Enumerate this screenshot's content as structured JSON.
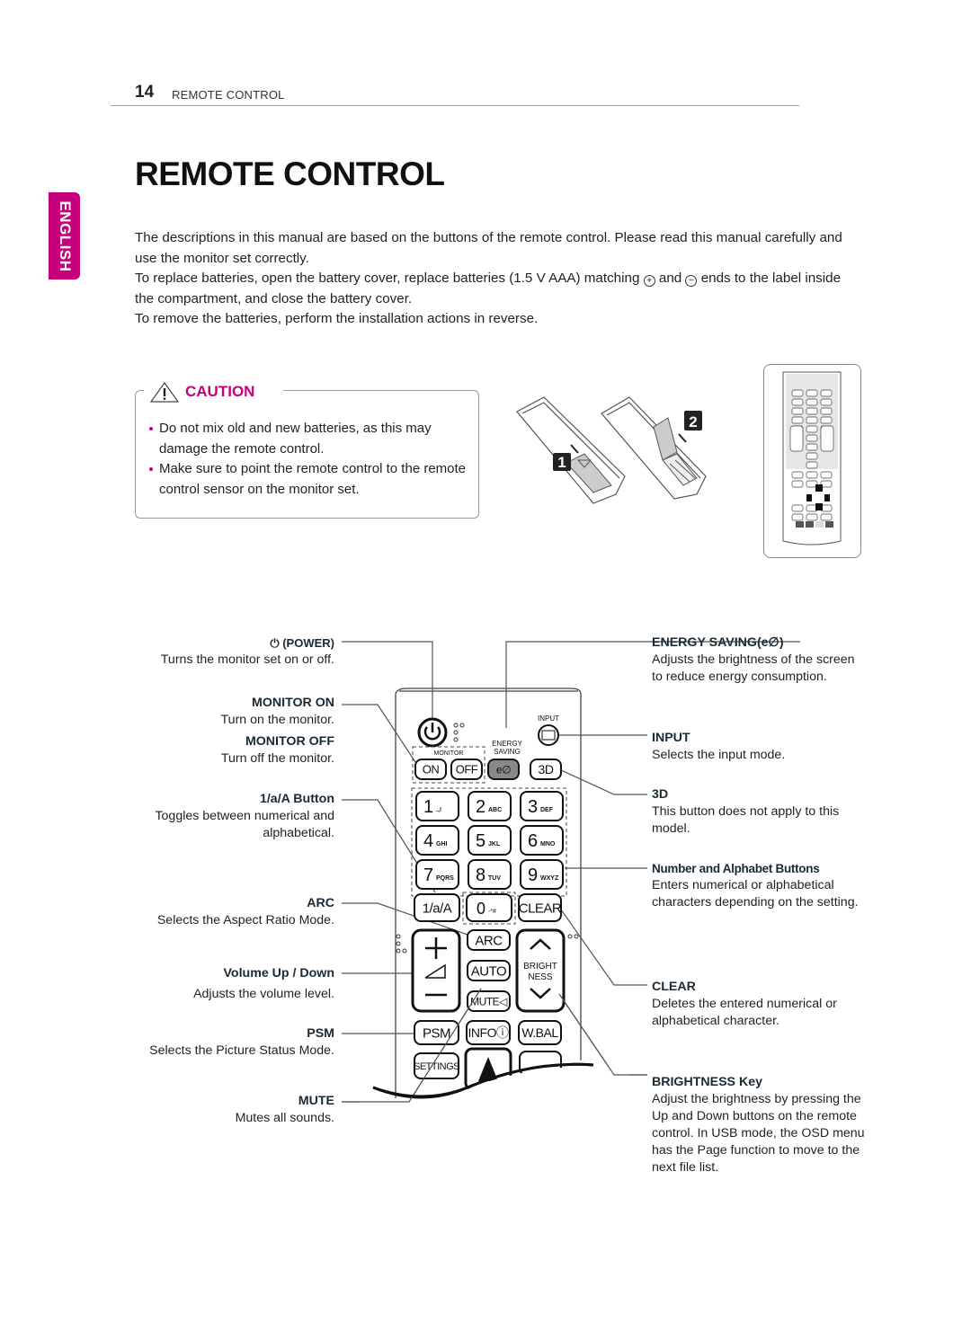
{
  "header": {
    "page_number": "14",
    "section": "REMOTE CONTROL"
  },
  "title": "REMOTE CONTROL",
  "language_tab": "ENGLISH",
  "intro": {
    "p1": "The descriptions in this manual are based on the buttons of the remote control. Please read this manual carefully and use the monitor set correctly.",
    "p2_before": "To replace batteries, open the battery cover, replace batteries (1.5 V AAA) matching",
    "p2_plus": "+",
    "p2_and": "and",
    "p2_minus": "−",
    "p2_after": "ends to the label inside the compartment, and close the battery cover.",
    "p3": "To remove the batteries, perform the installation actions in reverse."
  },
  "caution": {
    "label": "CAUTION",
    "items": [
      "Do not mix old and new batteries, as this may damage the remote control.",
      "Make sure to point the remote control to the remote control sensor on the monitor set."
    ]
  },
  "battery_steps": [
    "1",
    "2"
  ],
  "left_labels": [
    {
      "title": "(POWER)",
      "desc": "Turns the monitor set on or off."
    },
    {
      "title": "MONITOR ON",
      "desc": "Turn on the monitor."
    },
    {
      "title": "MONITOR OFF",
      "desc": "Turn off the monitor."
    },
    {
      "title": "1/a/A Button",
      "desc": "Toggles between numerical and alphabetical."
    },
    {
      "title": "ARC",
      "desc": "Selects the Aspect Ratio Mode."
    },
    {
      "title": "Volume Up / Down",
      "desc": "Adjusts the volume level."
    },
    {
      "title": "PSM",
      "desc": "Selects the Picture Status Mode."
    },
    {
      "title": "MUTE",
      "desc": "Mutes all sounds."
    }
  ],
  "right_labels": [
    {
      "title": "ENERGY SAVING(e∅)",
      "desc": "Adjusts the brightness of the screen to reduce energy consumption."
    },
    {
      "title": "INPUT",
      "desc": "Selects the input mode."
    },
    {
      "title": "3D",
      "desc": "This button does not apply to this model."
    },
    {
      "title": "Number and Alphabet Buttons",
      "desc": "Enters numerical or alphabetical characters depending on the setting."
    },
    {
      "title": "CLEAR",
      "desc": "Deletes the entered numerical or alphabetical character."
    },
    {
      "title": "BRIGHTNESS Key",
      "desc": "Adjust the brightness by pressing the Up and Down buttons on the remote control. In USB mode, the OSD menu has the Page function to move to the next file list."
    }
  ],
  "remote": {
    "input_label": "INPUT",
    "energy_label_1": "ENERGY",
    "energy_label_2": "SAVING",
    "monitor_label": "MONITOR",
    "on": "ON",
    "off": "OFF",
    "eco": "e∅",
    "three_d": "3D",
    "keys": [
      {
        "n": "1",
        "s": ".,!"
      },
      {
        "n": "2",
        "s": "ABC"
      },
      {
        "n": "3",
        "s": "DEF"
      },
      {
        "n": "4",
        "s": "GHI"
      },
      {
        "n": "5",
        "s": "JKL"
      },
      {
        "n": "6",
        "s": "MNO"
      },
      {
        "n": "7",
        "s": "PQRS"
      },
      {
        "n": "8",
        "s": "TUV"
      },
      {
        "n": "9",
        "s": "WXYZ"
      }
    ],
    "toggle": "1/a/A",
    "zero": "0",
    "zero_sub": "-*#",
    "clear": "CLEAR",
    "arc": "ARC",
    "auto": "AUTO",
    "mute": "MUTE",
    "bright_1": "BRIGHT",
    "bright_2": "NESS",
    "psm": "PSM",
    "info": "INFO",
    "wbal": "W.BAL",
    "settings": "SETTINGS"
  }
}
